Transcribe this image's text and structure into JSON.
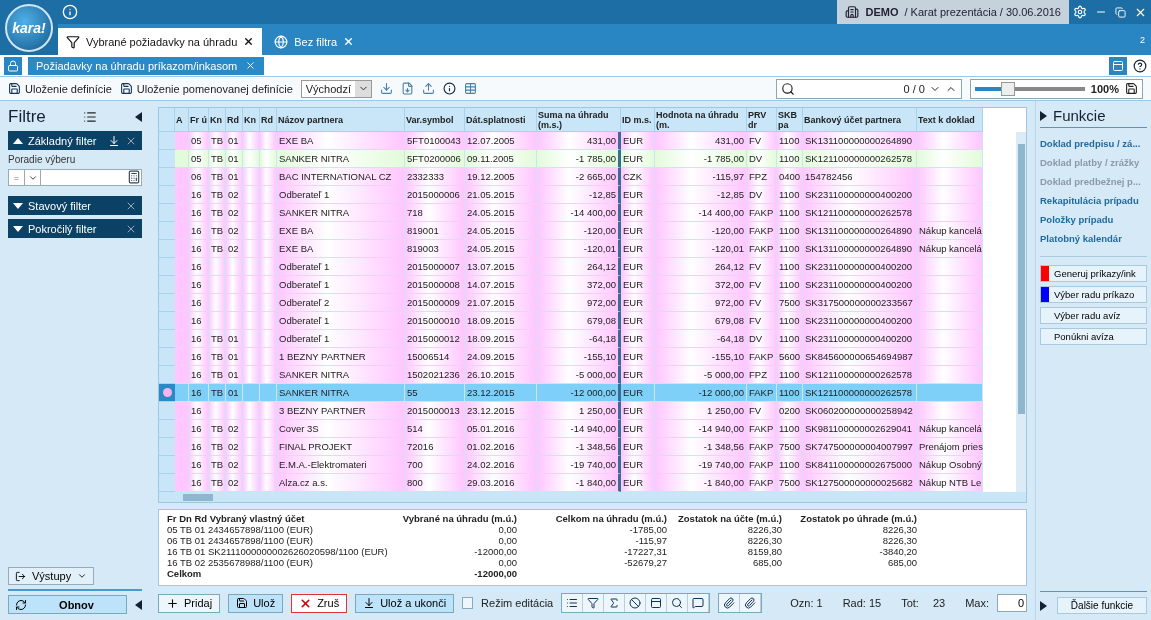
{
  "logo": "kara!",
  "top_bar": {
    "company": "DEMO",
    "context": "/ Karat prezentácia / 30.06.2016"
  },
  "tabs": [
    {
      "label": "Vybrané požiadavky na úhradu",
      "selected": true
    },
    {
      "label": "Bez filtra",
      "selected": false
    }
  ],
  "tab_count": "2",
  "subtab": {
    "label": "Požiadavky na úhradu príkazom/inkasom"
  },
  "toolbar": {
    "save": "Uloženie definície",
    "save_named": "Uloženie pomenovanej definície",
    "definition": "Východzí",
    "search_counter": "0 / 0",
    "zoom": {
      "level": 0.3,
      "label": "100%"
    }
  },
  "filters": {
    "title": "Filtre",
    "sections": [
      {
        "label": "Základný filter",
        "expanded": true
      },
      {
        "label": "Stavový filter",
        "expanded": false
      },
      {
        "label": "Pokročilý filter",
        "expanded": false
      }
    ],
    "field_label": "Poradie výberu",
    "operator": "=",
    "outputs": "Výstupy",
    "refresh": "Obnov"
  },
  "table": {
    "columns": [
      "A",
      "Fr ú",
      "Kn",
      "Rd",
      "Kn",
      "Rd",
      "Názov partnera",
      "Var.symbol",
      "Dát.splatnosti",
      "Suma na úhradu (m.s.)",
      "ID m.s.",
      "Hodnota na úhradu (m.",
      "PRV dr",
      "SKB pa",
      "Bankový účet partnera",
      "Text k doklad"
    ],
    "rows": [
      {
        "selected": false,
        "color": "#ffc6ff",
        "fr": "05",
        "kn": "TB",
        "rd": "01",
        "name": "EXE BA",
        "var": "5FT0100043",
        "date": "12.07.2005",
        "sum": "431,00",
        "cur": "EUR",
        "value": "431,00",
        "prv": "FV",
        "skb": "1100",
        "account": "SK131100000000264890"
      },
      {
        "selected": false,
        "color": "#e2fbd9",
        "fr": "05",
        "kn": "TB",
        "rd": "01",
        "name": "SANKER NITRA",
        "var": "5FT0200006",
        "date": "09.11.2005",
        "sum": "-1 785,00",
        "cur": "EUR",
        "value": "-1 785,00",
        "prv": "DV",
        "skb": "1100",
        "account": "SK121100000000262578"
      },
      {
        "selected": false,
        "color": "#ffc6ff",
        "fr": "06",
        "kn": "TB",
        "rd": "01",
        "name": "BAC INTERNATIONAL CZ",
        "var": "2332333",
        "date": "19.12.2005",
        "sum": "-2 665,00",
        "cur": "CZK",
        "value": "-115,97",
        "prv": "FPZ",
        "skb": "0400",
        "account": "154782456"
      },
      {
        "selected": false,
        "color": "#ffc6ff",
        "fr": "16",
        "kn": "TB",
        "rd": "02",
        "name": "Odberateľ 1",
        "var": "2015000006",
        "date": "21.05.2015",
        "sum": "-12,85",
        "cur": "EUR",
        "value": "-12,85",
        "prv": "DV",
        "skb": "1100",
        "account": "SK231100000000400200"
      },
      {
        "selected": false,
        "color": "#ffc6ff",
        "fr": "16",
        "kn": "TB",
        "rd": "02",
        "name": "SANKER NITRA",
        "var": "718",
        "date": "24.05.2015",
        "sum": "-14 400,00",
        "cur": "EUR",
        "value": "-14 400,00",
        "prv": "FAKP",
        "skb": "1100",
        "account": "SK121100000000262578"
      },
      {
        "selected": false,
        "color": "#ffc6ff",
        "fr": "16",
        "kn": "TB",
        "rd": "02",
        "name": "EXE BA",
        "var": "819001",
        "date": "24.05.2015",
        "sum": "-120,00",
        "cur": "EUR",
        "value": "-120,00",
        "prv": "FAKP",
        "skb": "1100",
        "account": "SK131100000000264890",
        "text": "Nákup kancelá"
      },
      {
        "selected": false,
        "color": "#ffc6ff",
        "fr": "16",
        "kn": "TB",
        "rd": "02",
        "name": "EXE BA",
        "var": "819003",
        "date": "24.05.2015",
        "sum": "-120,01",
        "cur": "EUR",
        "value": "-120,01",
        "prv": "FAKP",
        "skb": "1100",
        "account": "SK131100000000264890",
        "text": "Nákup kancelá"
      },
      {
        "selected": false,
        "color": "#ffc6ff",
        "fr": "16",
        "name": "Odberateľ 1",
        "var": "2015000007",
        "date": "13.07.2015",
        "sum": "264,12",
        "cur": "EUR",
        "value": "264,12",
        "prv": "FV",
        "skb": "1100",
        "account": "SK231100000000400200"
      },
      {
        "selected": false,
        "color": "#ffc6ff",
        "fr": "16",
        "name": "Odberateľ 1",
        "var": "2015000008",
        "date": "14.07.2015",
        "sum": "372,00",
        "cur": "EUR",
        "value": "372,00",
        "prv": "FV",
        "skb": "1100",
        "account": "SK231100000000400200"
      },
      {
        "selected": false,
        "color": "#ffc6ff",
        "fr": "16",
        "name": "Odberateľ 2",
        "var": "2015000009",
        "date": "21.07.2015",
        "sum": "972,00",
        "cur": "EUR",
        "value": "972,00",
        "prv": "FV",
        "skb": "7500",
        "account": "SK317500000000233567"
      },
      {
        "selected": false,
        "color": "#ffc6ff",
        "fr": "16",
        "name": "Odberateľ 1",
        "var": "2015000010",
        "date": "18.09.2015",
        "sum": "679,08",
        "cur": "EUR",
        "value": "679,08",
        "prv": "FV",
        "skb": "1100",
        "account": "SK231100000000400200"
      },
      {
        "selected": false,
        "color": "#ffc6ff",
        "fr": "16",
        "kn": "TB",
        "rd": "01",
        "name": "Odberateľ 1",
        "var": "2015000012",
        "date": "18.09.2015",
        "sum": "-64,18",
        "cur": "EUR",
        "value": "-64,18",
        "prv": "DV",
        "skb": "1100",
        "account": "SK231100000000400200"
      },
      {
        "selected": false,
        "color": "#ffc6ff",
        "fr": "16",
        "kn": "TB",
        "rd": "01",
        "name": "1 BEZNY PARTNER",
        "var": "15006514",
        "date": "24.09.2015",
        "sum": "-155,10",
        "cur": "EUR",
        "value": "-155,10",
        "prv": "FAKP",
        "skb": "5600",
        "account": "SK845600000654694987"
      },
      {
        "selected": false,
        "color": "#ffc6ff",
        "fr": "16",
        "kn": "TB",
        "rd": "01",
        "name": "SANKER NITRA",
        "var": "1502021236",
        "date": "26.10.2015",
        "sum": "-5 000,00",
        "cur": "EUR",
        "value": "-5 000,00",
        "prv": "FPZ",
        "skb": "1100",
        "account": "SK121100000000262578"
      },
      {
        "selected": true,
        "fr": "16",
        "kn": "TB",
        "rd": "01",
        "name": "SANKER NITRA",
        "var": "55",
        "date": "23.12.2015",
        "sum": "-12 000,00",
        "cur": "EUR",
        "value": "-12 000,00",
        "prv": "FAKP",
        "skb": "1100",
        "account": "SK121100000000262578"
      },
      {
        "selected": false,
        "color": "#ffc6ff",
        "fr": "16",
        "name": "3 BEZNY PARTNER",
        "var": "2015000013",
        "date": "23.12.2015",
        "sum": "1 250,00",
        "cur": "EUR",
        "value": "1 250,00",
        "prv": "FV",
        "skb": "0200",
        "account": "SK060200000000258942"
      },
      {
        "selected": false,
        "color": "#ffc6ff",
        "fr": "16",
        "kn": "TB",
        "rd": "02",
        "name": "Cover 3S",
        "var": "514",
        "date": "05.01.2016",
        "sum": "-14 940,00",
        "cur": "EUR",
        "value": "-14 940,00",
        "prv": "FAKP",
        "skb": "1100",
        "account": "SK981100000002629041",
        "text": "Nákup kancelá"
      },
      {
        "selected": false,
        "color": "#ffc6ff",
        "fr": "16",
        "kn": "TB",
        "rd": "02",
        "name": "FINAL PROJEKT",
        "var": "72016",
        "date": "01.02.2016",
        "sum": "-1 348,56",
        "cur": "EUR",
        "value": "-1 348,56",
        "prv": "FAKP",
        "skb": "7500",
        "account": "SK747500000004007997",
        "text": "Prenájom pries"
      },
      {
        "selected": false,
        "color": "#ffc6ff",
        "fr": "16",
        "kn": "TB",
        "rd": "02",
        "name": "E.M.A.-Elektromateri",
        "var": "700",
        "date": "24.02.2016",
        "sum": "-19 740,00",
        "cur": "EUR",
        "value": "-19 740,00",
        "prv": "FAKP",
        "skb": "1100",
        "account": "SK841100000002675000",
        "text": "Nákup Osobný"
      },
      {
        "selected": false,
        "color": "#ffc6ff",
        "fr": "16",
        "kn": "TB",
        "rd": "02",
        "name": "Alza.cz a.s.",
        "var": "800",
        "date": "29.03.2016",
        "sum": "-1 840,00",
        "cur": "EUR",
        "value": "-1 840,00",
        "prv": "FAKP",
        "skb": "7500",
        "account": "SK127500000000025682",
        "text": "Nákup NTB Le"
      }
    ]
  },
  "summary": {
    "columns": [
      "Fr Dn Rd Vybraný vlastný účet",
      "Vybrané na úhradu (m.ú.)",
      "Celkom na úhradu (m.ú.)",
      "Zostatok na účte (m.ú.)",
      "Zostatok po úhrade (m.ú.)"
    ],
    "rows": [
      [
        "05 TB 01 2434657898/1100 (EUR)",
        "0,00",
        "-1785,00",
        "8226,30",
        "8226,30"
      ],
      [
        "06 TB 01 2434657898/1100 (EUR)",
        "0,00",
        "-115,97",
        "8226,30",
        "8226,30"
      ],
      [
        "16 TB 01 SK2111000000002626020598/1100  (EUR)",
        "-12000,00",
        "-17227,31",
        "8159,80",
        "-3840,20"
      ],
      [
        "16 TB 02 2535678988/1100 (EUR)",
        "0,00",
        "-52679,27",
        "685,00",
        "685,00"
      ]
    ],
    "total_label": "Celkom",
    "total_value": "-12000,00"
  },
  "bottom_bar": {
    "add": "Pridaj",
    "save": "Ulož",
    "cancel": "Zruš",
    "save_close": "Ulož a ukonči",
    "edit_mode": {
      "label": "Režim editácia",
      "checked": false
    },
    "marked": "Ozn: 1",
    "row": "Rad: 15",
    "total_label": "Tot:",
    "total": "23",
    "max_label": "Max:",
    "max": "0"
  },
  "functions": {
    "title": "Funkcie",
    "links": [
      {
        "label": "Doklad predpisu / zá...",
        "disabled": false
      },
      {
        "label": "Doklad platby / zrážky",
        "disabled": true
      },
      {
        "label": "Doklad predbežnej p...",
        "disabled": true
      },
      {
        "label": "Rekapitulácia prípadu",
        "disabled": false
      },
      {
        "label": "Položky prípadu",
        "disabled": false
      },
      {
        "label": "Platobný kalendár",
        "disabled": false
      }
    ],
    "actions": [
      {
        "label": "Generuj príkazy/ink",
        "color": "#ff0000"
      },
      {
        "label": "Výber radu príkazo",
        "color": "#0000ff"
      },
      {
        "label": "Výber radu avíz"
      },
      {
        "label": "Ponúkni avíza"
      }
    ],
    "more": "Ďalšie funkcie"
  }
}
